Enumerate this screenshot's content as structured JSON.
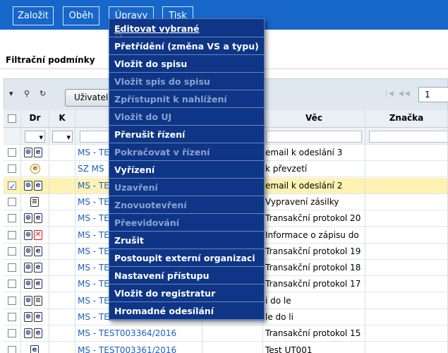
{
  "toolbar": {
    "zalozit": "Založit",
    "obeh": "Oběh",
    "upravy": "Úpravy",
    "tisk": "Tisk"
  },
  "filter": {
    "label": "Filtrační podmínky"
  },
  "gridbar": {
    "user_button": "Uživatel",
    "pager_nav": "|◀ ◀◀",
    "page_value": "1"
  },
  "grid": {
    "headers": {
      "dr": "Dr",
      "k": "K",
      "vec": "Věc",
      "znacka": "Značka"
    },
    "rows": [
      {
        "checked": false,
        "icons": [
          "clip",
          "e"
        ],
        "id": "MS - TE",
        "vec": "email k odeslání 3",
        "selected": false
      },
      {
        "checked": false,
        "icons": [
          "eml"
        ],
        "id": "SZ MS",
        "vec": "k převzetí",
        "selected": false
      },
      {
        "checked": true,
        "icons": [
          "clip",
          "e"
        ],
        "id": "MS - TE",
        "vec": "email k odeslání 2",
        "selected": true
      },
      {
        "checked": false,
        "icons": [
          "doc"
        ],
        "id": "MS - TE",
        "vec": "Vypravení zásilky",
        "selected": false
      },
      {
        "checked": false,
        "icons": [
          "clip",
          "e"
        ],
        "id": "MS - TE",
        "vec": "Transakční protokol 20",
        "selected": false
      },
      {
        "checked": false,
        "icons": [
          "clip",
          "x"
        ],
        "id": "MS - TE",
        "vec": "Informace o zápisu do",
        "selected": false
      },
      {
        "checked": false,
        "icons": [
          "clip",
          "e"
        ],
        "id": "MS - TE",
        "vec": "Transakční protokol 19",
        "selected": false
      },
      {
        "checked": false,
        "icons": [
          "clip",
          "e"
        ],
        "id": "MS - TE",
        "vec": "Transakční protokol 18",
        "selected": false
      },
      {
        "checked": false,
        "icons": [
          "clip",
          "e"
        ],
        "id": "MS - TE",
        "vec": "Transakční protokol 17",
        "selected": false
      },
      {
        "checked": false,
        "icons": [
          "clip",
          "doc"
        ],
        "id": "MS - TE",
        "vec": "i do le",
        "selected": false
      },
      {
        "checked": false,
        "icons": [
          "clip",
          "e"
        ],
        "id": "MS - TE",
        "vec": "le do li",
        "selected": false
      },
      {
        "checked": false,
        "icons": [
          "clip",
          "e"
        ],
        "id": "MS - TEST003364/2016",
        "vec": "Transakční protokol 15",
        "selected": false
      },
      {
        "checked": false,
        "icons": [
          "e"
        ],
        "id": "MS - TEST003361/2016",
        "vec": "Test UT001",
        "selected": false
      }
    ]
  },
  "menu": {
    "items": [
      {
        "label": "Editovat vybrané",
        "disabled": false
      },
      {
        "label": "Přetřídění (změna VS a typu)",
        "disabled": false
      },
      {
        "label": "Vložit do spisu",
        "disabled": false
      },
      {
        "label": "Vložit spis do spisu",
        "disabled": true
      },
      {
        "label": "Zpřístupnit k nahlížení",
        "disabled": true
      },
      {
        "label": "Vložit do UJ",
        "disabled": true
      },
      {
        "label": "Přerušit řízení",
        "disabled": false
      },
      {
        "label": "Pokračovat v řízení",
        "disabled": true
      },
      {
        "label": "Vyřízení",
        "disabled": false
      },
      {
        "label": "Uzavření",
        "disabled": true
      },
      {
        "label": "Znovuotevření",
        "disabled": true
      },
      {
        "label": "Přeevidování",
        "disabled": true
      },
      {
        "label": "Zrušit",
        "disabled": false
      },
      {
        "label": "Postoupit externí organizaci",
        "disabled": false
      },
      {
        "label": "Nastavení přístupu",
        "disabled": false
      },
      {
        "label": "Vložit do registratur",
        "disabled": false
      },
      {
        "label": "Hromadné odesílání",
        "disabled": false
      }
    ]
  },
  "colors": {
    "toolbar_bg": "#1766c9",
    "menu_bg": "#0e3586",
    "selected_row": "#fdf2b3"
  }
}
